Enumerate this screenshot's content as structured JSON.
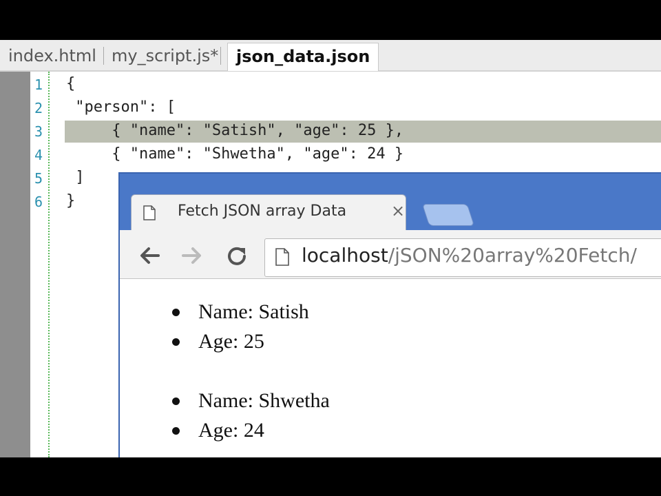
{
  "editor": {
    "tabs": [
      {
        "label": "index.html"
      },
      {
        "label": "my_script.js*"
      },
      {
        "label": "json_data.json"
      }
    ],
    "active_tab": "json_data.json",
    "lines": [
      {
        "num": "1",
        "text": "{"
      },
      {
        "num": "2",
        "text": " \"person\": ["
      },
      {
        "num": "3",
        "text": "     { \"name\": \"Satish\", \"age\": 25 },"
      },
      {
        "num": "4",
        "text": "     { \"name\": \"Shwetha\", \"age\": 24 }"
      },
      {
        "num": "5",
        "text": " ]"
      },
      {
        "num": "6",
        "text": "}"
      }
    ],
    "highlighted_line": "3",
    "colors": {
      "line_number": "#2b91af",
      "highlight": "#bcbfb2",
      "gutter": "#8e8e8e"
    }
  },
  "browser": {
    "tab_title": "Fetch JSON array Data",
    "close_glyph": "×",
    "url_host": "localhost",
    "url_path": "/jSON%20array%20Fetch/",
    "icons": {
      "back": "arrow-left-icon",
      "forward": "arrow-right-icon",
      "reload": "reload-icon",
      "page": "page-icon"
    },
    "frame_color": "#4a78c8",
    "people": [
      {
        "name": "Name: Satish",
        "age": "Age: 25"
      },
      {
        "name": "Name: Shwetha",
        "age": "Age: 24"
      }
    ]
  }
}
